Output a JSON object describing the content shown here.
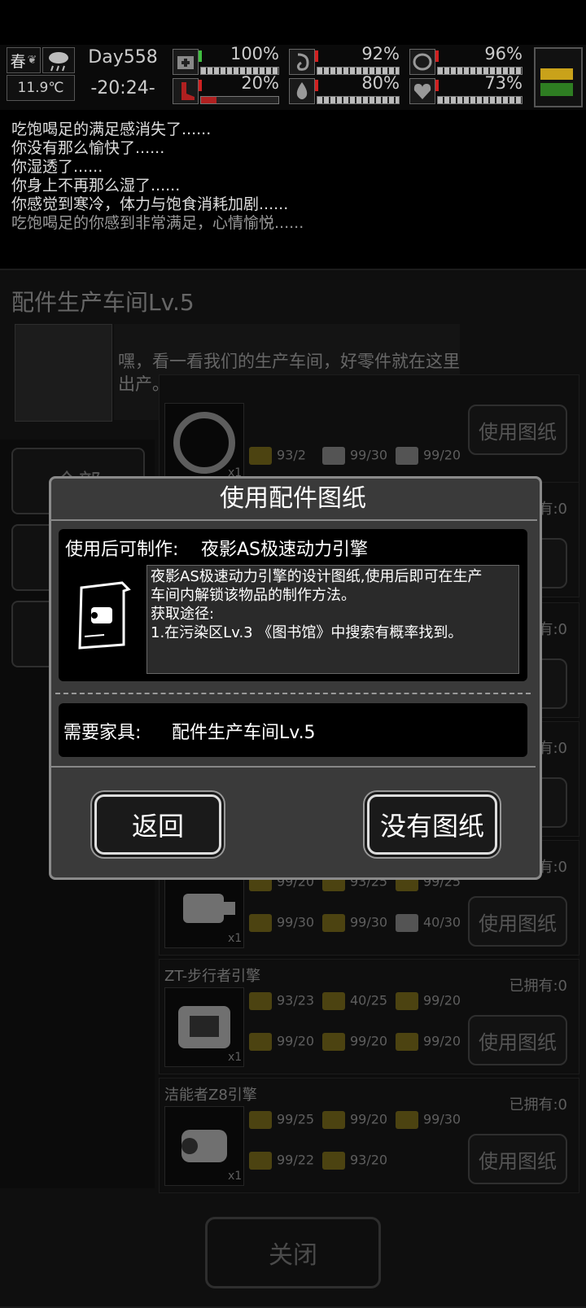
{
  "status": {
    "season": "春",
    "temperature": "11.9℃",
    "day": "Day558",
    "time": "-20:24-",
    "meters": [
      {
        "icon": "medkit-icon",
        "value": "100%"
      },
      {
        "icon": "stomach-icon",
        "value": "92%"
      },
      {
        "icon": "pot-icon",
        "value": "96%"
      },
      {
        "icon": "boot-icon",
        "value": "20%"
      },
      {
        "icon": "water-drop-icon",
        "value": "80%"
      },
      {
        "icon": "heart-icon",
        "value": "73%"
      }
    ],
    "colors": {
      "up": "#3fbf3f",
      "down": "#d02020",
      "battery_yellow": "#c9a21a",
      "battery_green": "#2e7d22"
    }
  },
  "log": [
    "吃饱喝足的满足感消失了......",
    "你没有那么愉快了......",
    "你湿透了......",
    "你身上不再那么湿了......",
    "你感觉到寒冷，体力与饱食消耗加剧......",
    "吃饱喝足的你感到非常满足，心情愉悦......"
  ],
  "workshop": {
    "title": "配件生产车间Lv.5",
    "npc_line": "嘿，看一看我们的生产车间，好零件就在这里出产。",
    "tabs": [
      "全部",
      "",
      "载"
    ],
    "items": [
      {
        "name": "",
        "owned": "",
        "mats": [
          "93/2",
          "99/30",
          "99/20"
        ],
        "btn": "使用图纸"
      },
      {
        "name": "",
        "owned": "有:0",
        "mats": [],
        "btn": ""
      },
      {
        "name": "",
        "owned": "有:0",
        "mats": [],
        "btn": ""
      },
      {
        "name": "",
        "owned": "有:0",
        "mats": [],
        "btn": ""
      },
      {
        "name": "",
        "owned": "有:0",
        "mats": [
          "99/20",
          "93/25",
          "99/25",
          "99/30",
          "99/30",
          "40/30"
        ],
        "btn": "使用图纸"
      },
      {
        "name": "ZT-步行者引擎",
        "owned": "已拥有:0",
        "mats": [
          "93/23",
          "40/25",
          "99/20",
          "99/20",
          "99/20",
          "99/20"
        ],
        "btn": "使用图纸"
      },
      {
        "name": "洁能者Z8引擎",
        "owned": "已拥有:0",
        "mats": [
          "99/25",
          "99/20",
          "99/30",
          "99/22",
          "93/20"
        ],
        "btn": "使用图纸"
      }
    ],
    "x1": "x1",
    "close_label": "关闭"
  },
  "modal": {
    "title": "使用配件图纸",
    "produce_label": "使用后可制作:",
    "produce_target": "夜影AS极速动力引擎",
    "description_lines": [
      "夜影AS极速动力引擎的设计图纸,使用后即可在生产",
      "车间内解锁该物品的制作方法。",
      "获取途径:",
      "1.在污染区Lv.3 《图书馆》中搜索有概率找到。"
    ],
    "need_label": "需要家具:",
    "need_value": "配件生产车间Lv.5",
    "back_label": "返回",
    "no_blueprint_label": "没有图纸"
  }
}
